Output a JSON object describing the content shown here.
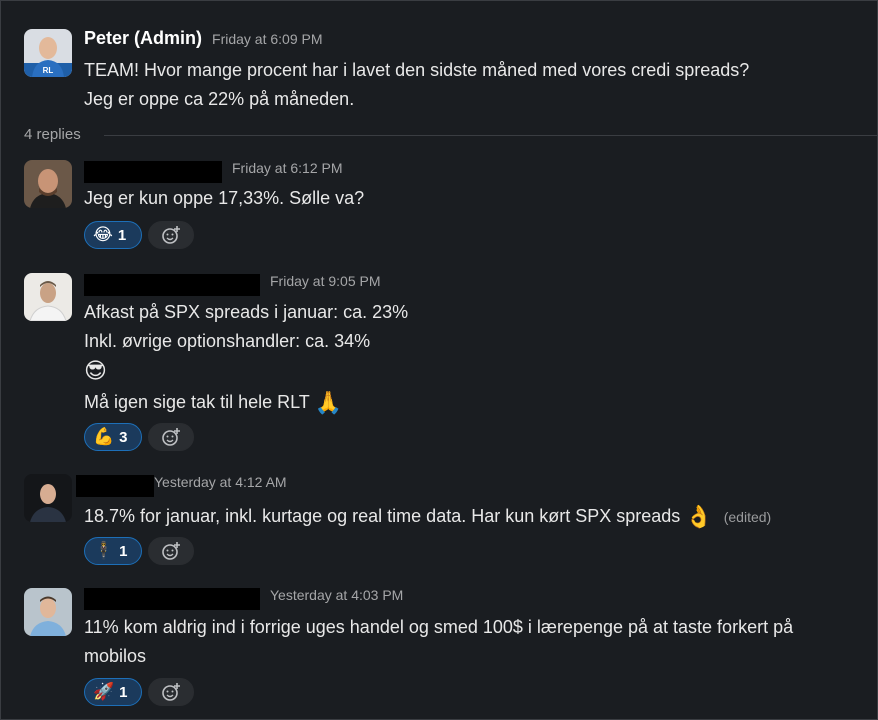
{
  "thread": {
    "parent": {
      "author": "Peter (Admin)",
      "time": "Friday at 6:09 PM",
      "lines": [
        "TEAM! Hvor mange procent har i lavet den sidste måned med vores credi spreads?",
        "Jeg er oppe ca 22% på måneden."
      ]
    },
    "replies_label": "4 replies",
    "replies": [
      {
        "time": "Friday at 6:12 PM",
        "lines": [
          "Jeg er kun oppe 17,33%. Sølle va?"
        ],
        "reaction": {
          "emoji": "😂",
          "count": "1"
        }
      },
      {
        "time": "Friday at 9:05 PM",
        "lines": [
          "Afkast på SPX spreads i januar: ca. 23%",
          "Inkl. øvrige optionshandler: ca. 34%",
          "😎",
          "Må igen sige tak til hele RLT"
        ],
        "line_suffix_emoji": "🙏",
        "reaction": {
          "emoji": "💪",
          "count": "3"
        }
      },
      {
        "time": "Yesterday at 4:12 AM",
        "lines": [
          "18.7% for januar, inkl. kurtage og real time data. Har kun kørt SPX spreads"
        ],
        "line_suffix_emoji": "👌",
        "edited": "(edited)",
        "reaction": {
          "emoji": "🕴",
          "count": "1"
        }
      },
      {
        "time": "Yesterday at 4:03 PM",
        "lines": [
          "11% kom aldrig ind i forrige uges handel og smed 100$ i lærepenge på at taste forkert på",
          "mobilos"
        ],
        "reaction": {
          "emoji": "🚀",
          "count": "1"
        }
      }
    ]
  },
  "colors": {
    "background": "#1a1d21",
    "reaction_bg": "#1b3a5c",
    "reaction_border": "#1d6fb8"
  },
  "icons": {
    "add_reaction": "add-reaction-icon"
  }
}
